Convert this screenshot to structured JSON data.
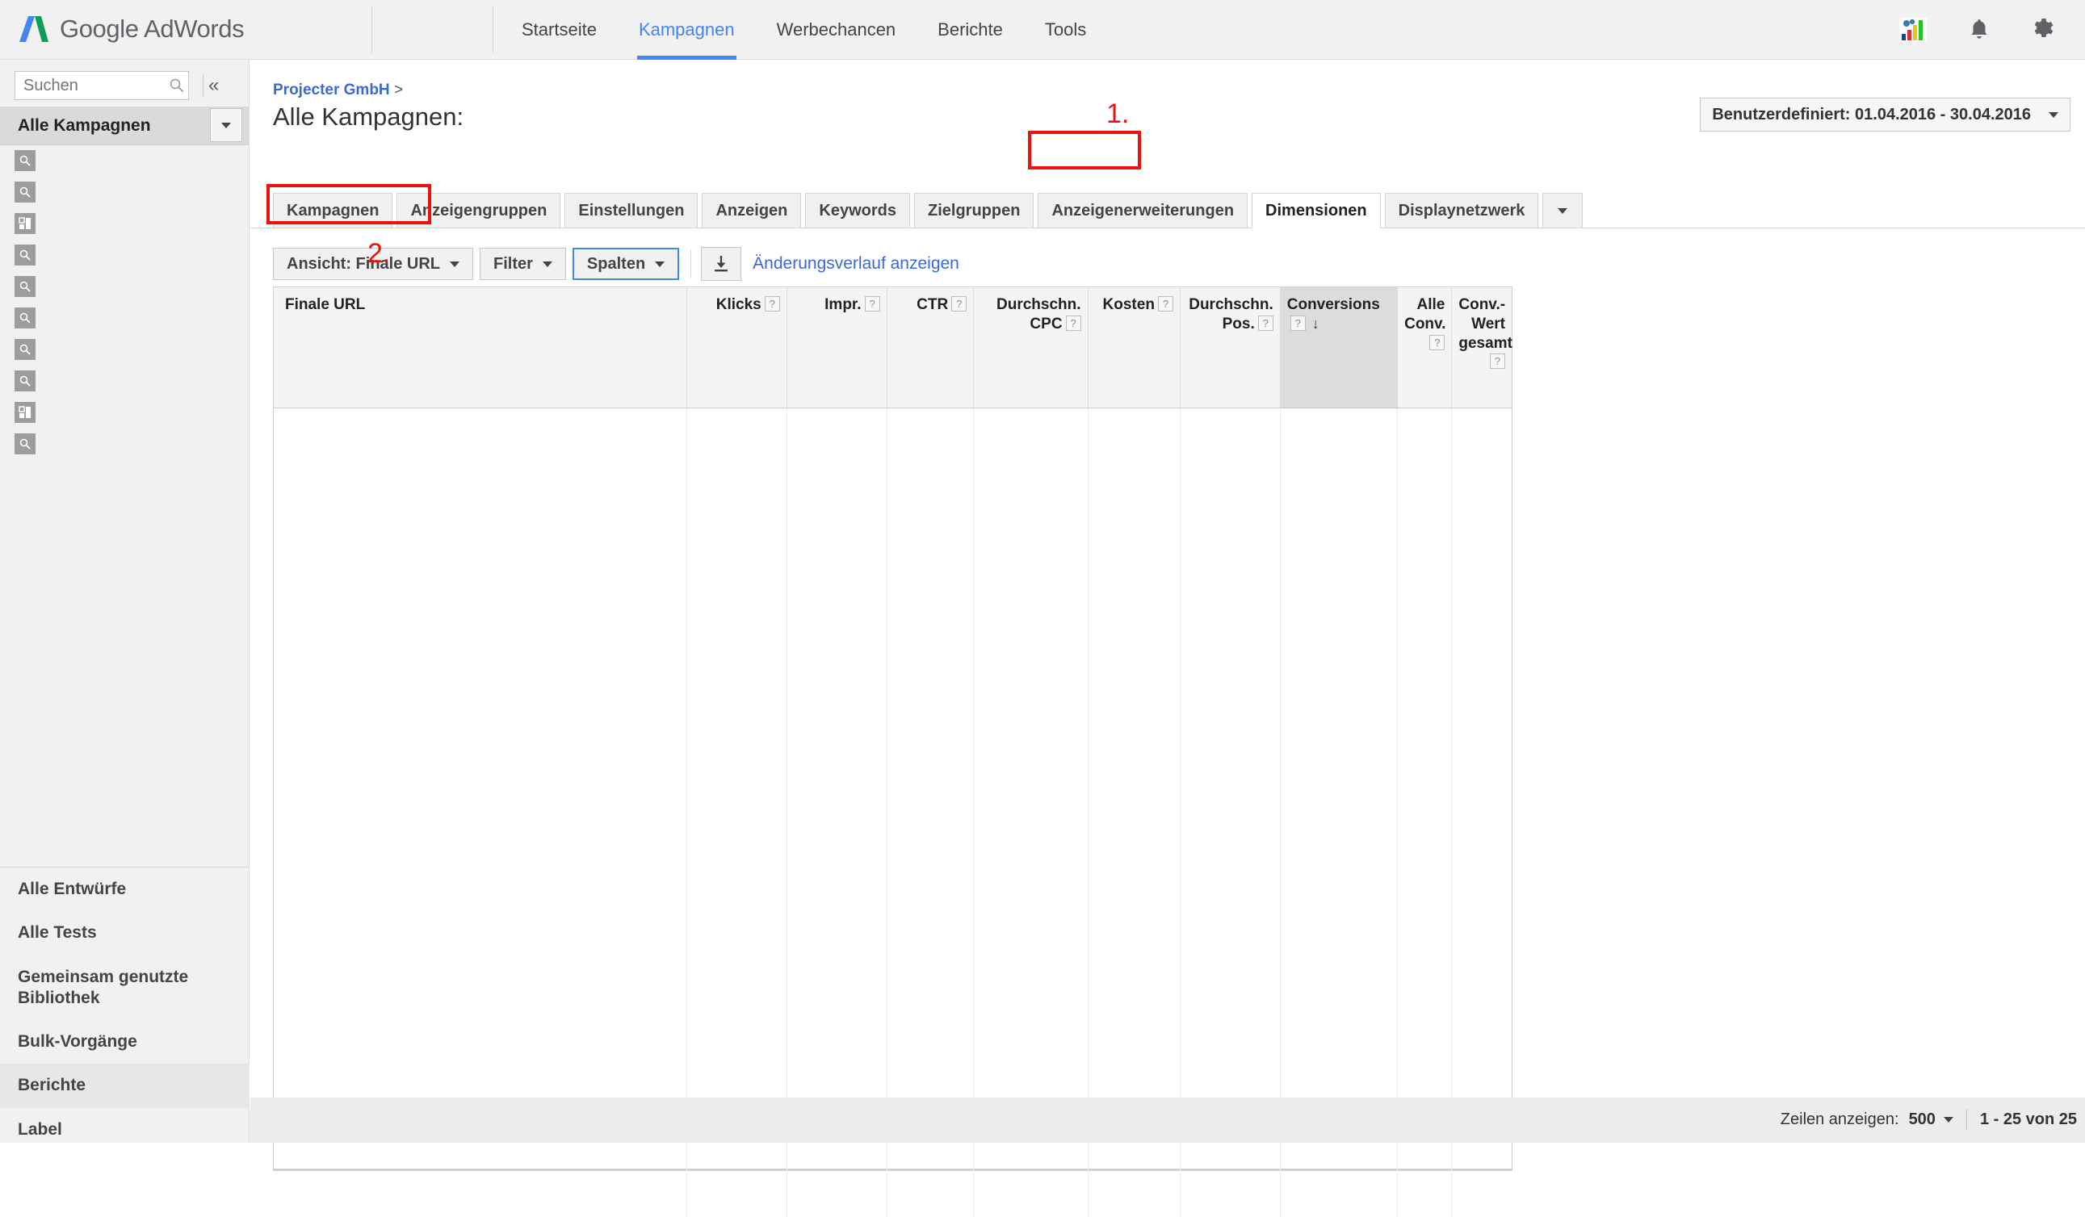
{
  "app": {
    "brand_google": "Google",
    "brand_product": "AdWords",
    "accent_blue": "#4285f4",
    "annotation_red": "#ee1111"
  },
  "topnav": {
    "items": [
      {
        "label": "Startseite",
        "active": false
      },
      {
        "label": "Kampagnen",
        "active": true
      },
      {
        "label": "Werbechancen",
        "active": false
      },
      {
        "label": "Berichte",
        "active": false
      },
      {
        "label": "Tools",
        "active": false
      }
    ],
    "icons": [
      {
        "name": "reports-chart-icon",
        "glyph": "chart"
      },
      {
        "name": "notifications-bell-icon",
        "glyph": "bell"
      },
      {
        "name": "settings-gear-icon",
        "glyph": "gear"
      }
    ]
  },
  "sidebar": {
    "search": {
      "value": "",
      "placeholder": "Suchen",
      "icon": "search-icon"
    },
    "collapse_glyph": "«",
    "account_selector": {
      "label": "Alle Kampagnen",
      "dropdown_glyph": "▼"
    },
    "placeholder_icons": [
      "search-placeholder-icon",
      "search-placeholder-icon",
      "layout-placeholder-icon",
      "search-placeholder-icon",
      "search-placeholder-icon",
      "search-placeholder-icon",
      "search-placeholder-icon",
      "search-placeholder-icon",
      "layout-placeholder-icon",
      "search-placeholder-icon"
    ],
    "links": [
      {
        "label": "Alle Entwürfe",
        "highlighted": false
      },
      {
        "label": "Alle Tests",
        "highlighted": false
      },
      {
        "label": "Gemeinsam genutzte Bibliothek",
        "highlighted": false
      },
      {
        "label": "Bulk-Vorgänge",
        "highlighted": false
      },
      {
        "label": "Berichte",
        "highlighted": true
      },
      {
        "label": "Label",
        "highlighted": false
      }
    ]
  },
  "header": {
    "breadcrumb_account": "Projecter GmbH",
    "breadcrumb_sep": ">",
    "page_title": "Alle Kampagnen:",
    "date_range": "Benutzerdefiniert: 01.04.2016 - 30.04.2016"
  },
  "tabs": [
    {
      "label": "Kampagnen",
      "active": false
    },
    {
      "label": "Anzeigengruppen",
      "active": false
    },
    {
      "label": "Einstellungen",
      "active": false
    },
    {
      "label": "Anzeigen",
      "active": false
    },
    {
      "label": "Keywords",
      "active": false
    },
    {
      "label": "Zielgruppen",
      "active": false
    },
    {
      "label": "Anzeigenerweiterungen",
      "active": false
    },
    {
      "label": "Dimensionen",
      "active": true
    },
    {
      "label": "Displaynetzwerk",
      "active": false
    }
  ],
  "tabs_more_glyph": "▼",
  "toolbar": {
    "view_button": "Ansicht: Finale URL",
    "filter_button": "Filter",
    "columns_button": "Spalten",
    "download_icon": "download-icon",
    "change_history_link": "Änderungsverlauf anzeigen"
  },
  "table": {
    "columns": [
      {
        "label": "Finale URL",
        "help": false,
        "align": "left",
        "sorted": false
      },
      {
        "label": "Klicks",
        "help": true,
        "align": "right",
        "sorted": false
      },
      {
        "label": "Impr.",
        "help": true,
        "align": "right",
        "sorted": false
      },
      {
        "label": "CTR",
        "help": true,
        "align": "right",
        "sorted": false
      },
      {
        "label": "Durchschn. CPC",
        "help": true,
        "align": "right",
        "sorted": false
      },
      {
        "label": "Kosten",
        "help": true,
        "align": "right",
        "sorted": false
      },
      {
        "label": "Durchschn. Pos.",
        "help": true,
        "align": "right",
        "sorted": false
      },
      {
        "label": "Conversions",
        "help": true,
        "align": "left",
        "sorted": true,
        "sort_glyph": "↓"
      },
      {
        "label": "Alle Conv.",
        "help": true,
        "align": "right",
        "sorted": false
      },
      {
        "label": "Conv.-Wert gesamt",
        "help": true,
        "align": "right",
        "sorted": false
      }
    ],
    "rows": [],
    "help_glyph": "?"
  },
  "footer": {
    "rows_label": "Zeilen anzeigen:",
    "rows_value": "500",
    "rows_caret": "▼",
    "range_text": "1 - 25 von 25"
  },
  "annotations": [
    {
      "number": "1.",
      "target": "tab-dimensionen"
    },
    {
      "number": "2.",
      "target": "view-finale-url-button"
    }
  ]
}
